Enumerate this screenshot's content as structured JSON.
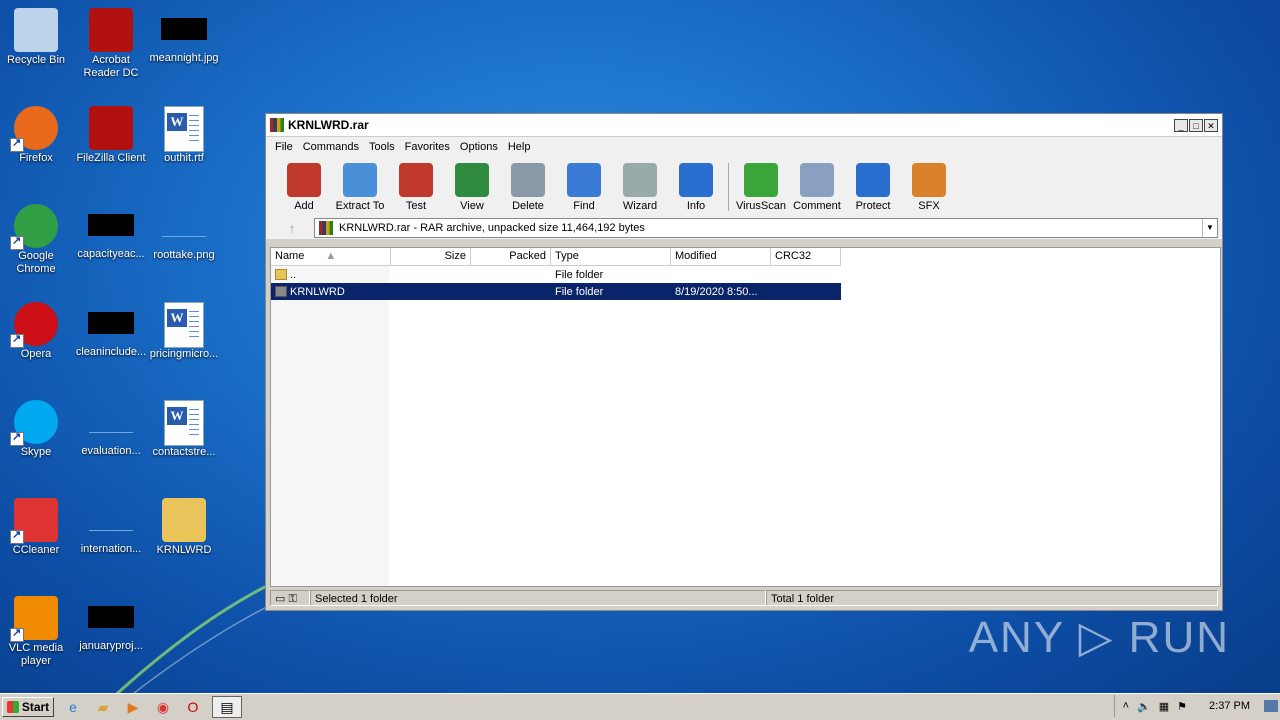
{
  "desktop": {
    "icons": [
      {
        "label": "Recycle Bin",
        "icon": "recycle-bin-icon"
      },
      {
        "label": "Acrobat Reader DC",
        "icon": "acrobat-icon"
      },
      {
        "label": "meannight.jpg",
        "icon": "image-file-icon"
      },
      {
        "label": "Firefox",
        "icon": "firefox-icon"
      },
      {
        "label": "FileZilla Client",
        "icon": "filezilla-icon"
      },
      {
        "label": "outhit.rtf",
        "icon": "word-doc-icon"
      },
      {
        "label": "Google Chrome",
        "icon": "chrome-icon"
      },
      {
        "label": "capacityeac...",
        "icon": "file-icon"
      },
      {
        "label": "roottake.png",
        "icon": "image-file-icon"
      },
      {
        "label": "Opera",
        "icon": "opera-icon"
      },
      {
        "label": "cleaninclude...",
        "icon": "file-icon"
      },
      {
        "label": "pricingmicro...",
        "icon": "word-doc-icon"
      },
      {
        "label": "Skype",
        "icon": "skype-icon"
      },
      {
        "label": "evaluation...",
        "icon": "file-icon"
      },
      {
        "label": "contactstre...",
        "icon": "word-doc-icon"
      },
      {
        "label": "CCleaner",
        "icon": "ccleaner-icon"
      },
      {
        "label": "internation...",
        "icon": "file-icon"
      },
      {
        "label": "KRNLWRD",
        "icon": "folder-icon"
      },
      {
        "label": "VLC media player",
        "icon": "vlc-icon"
      },
      {
        "label": "januaryproj...",
        "icon": "file-icon"
      }
    ]
  },
  "window": {
    "title": "KRNLWRD.rar",
    "menu": [
      "File",
      "Commands",
      "Tools",
      "Favorites",
      "Options",
      "Help"
    ],
    "toolbar": [
      {
        "label": "Add",
        "icon": "add-icon",
        "color": "#c0392b"
      },
      {
        "label": "Extract To",
        "icon": "extract-folder-icon",
        "color": "#4a90d9"
      },
      {
        "label": "Test",
        "icon": "test-clipboard-icon",
        "color": "#c0392b"
      },
      {
        "label": "View",
        "icon": "view-book-icon",
        "color": "#2e8b3e"
      },
      {
        "label": "Delete",
        "icon": "trash-icon",
        "color": "#8a9aa8"
      },
      {
        "label": "Find",
        "icon": "magnifier-icon",
        "color": "#3a7bd5"
      },
      {
        "label": "Wizard",
        "icon": "wand-icon",
        "color": "#9aa"
      },
      {
        "label": "Info",
        "icon": "info-icon",
        "color": "#2a6fd0"
      },
      {
        "label": "VirusScan",
        "icon": "virus-icon",
        "color": "#3aa53a"
      },
      {
        "label": "Comment",
        "icon": "comment-icon",
        "color": "#8aa0c0"
      },
      {
        "label": "Protect",
        "icon": "shield-icon",
        "color": "#2a6fd0"
      },
      {
        "label": "SFX",
        "icon": "sfx-icon",
        "color": "#d9822b"
      }
    ],
    "address": "KRNLWRD.rar - RAR archive, unpacked size 11,464,192 bytes",
    "columns": [
      "Name",
      "Size",
      "Packed",
      "Type",
      "Modified",
      "CRC32"
    ],
    "rows": [
      {
        "name": "..",
        "size": "",
        "packed": "",
        "type": "File folder",
        "modified": "",
        "crc": ""
      },
      {
        "name": "KRNLWRD",
        "size": "",
        "packed": "",
        "type": "File folder",
        "modified": "8/19/2020 8:50...",
        "crc": ""
      }
    ],
    "status_left": "Selected 1 folder",
    "status_right": "Total 1 folder"
  },
  "taskbar": {
    "start": "Start",
    "clock": "2:37 PM"
  },
  "watermark": "ANY ▷ RUN"
}
